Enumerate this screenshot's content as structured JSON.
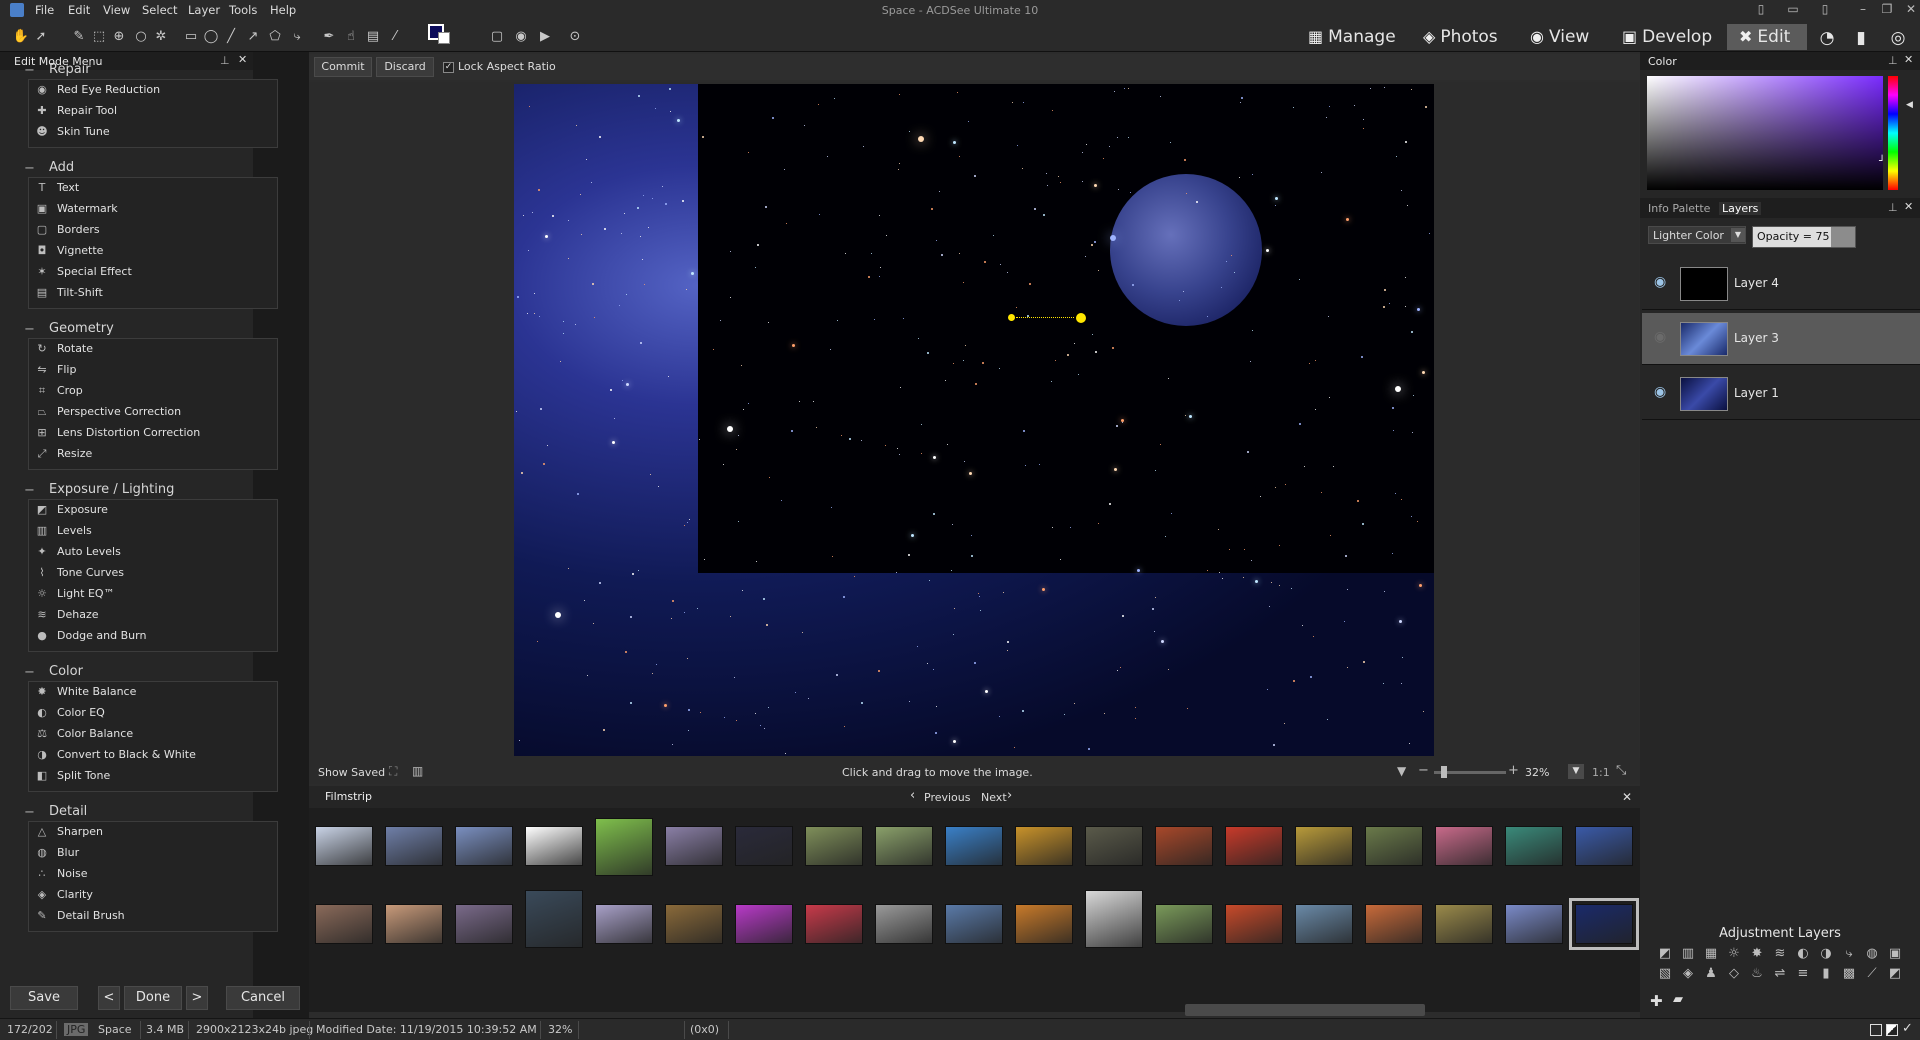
{
  "window": {
    "title": "Space - ACDSee Ultimate 10"
  },
  "menu": [
    "File",
    "Edit",
    "View",
    "Select",
    "Layer",
    "Tools",
    "Help"
  ],
  "modes": [
    {
      "label": "Manage",
      "icon": "grid-icon"
    },
    {
      "label": "Photos",
      "icon": "photos-icon"
    },
    {
      "label": "View",
      "icon": "eye-icon"
    },
    {
      "label": "Develop",
      "icon": "develop-icon"
    },
    {
      "label": "Edit",
      "icon": "edit-icon",
      "active": true
    }
  ],
  "left_panel": {
    "header": "Edit Mode Menu",
    "sections": [
      {
        "title": "Repair",
        "items": [
          {
            "label": "Red Eye Reduction",
            "icon": "eye-icon"
          },
          {
            "label": "Repair Tool",
            "icon": "bandage-icon"
          },
          {
            "label": "Skin Tune",
            "icon": "person-icon"
          }
        ]
      },
      {
        "title": "Add",
        "items": [
          {
            "label": "Text",
            "icon": "text-icon"
          },
          {
            "label": "Watermark",
            "icon": "watermark-icon"
          },
          {
            "label": "Borders",
            "icon": "border-icon"
          },
          {
            "label": "Vignette",
            "icon": "vignette-icon"
          },
          {
            "label": "Special Effect",
            "icon": "effect-icon"
          },
          {
            "label": "Tilt-Shift",
            "icon": "tiltshift-icon"
          }
        ]
      },
      {
        "title": "Geometry",
        "items": [
          {
            "label": "Rotate",
            "icon": "rotate-icon"
          },
          {
            "label": "Flip",
            "icon": "flip-icon"
          },
          {
            "label": "Crop",
            "icon": "crop-icon"
          },
          {
            "label": "Perspective Correction",
            "icon": "perspective-icon"
          },
          {
            "label": "Lens Distortion Correction",
            "icon": "lens-icon"
          },
          {
            "label": "Resize",
            "icon": "resize-icon"
          }
        ]
      },
      {
        "title": "Exposure / Lighting",
        "items": [
          {
            "label": "Exposure",
            "icon": "exposure-icon"
          },
          {
            "label": "Levels",
            "icon": "levels-icon"
          },
          {
            "label": "Auto Levels",
            "icon": "auto-levels-icon"
          },
          {
            "label": "Tone Curves",
            "icon": "curves-icon"
          },
          {
            "label": "Light EQ™",
            "icon": "light-eq-icon"
          },
          {
            "label": "Dehaze",
            "icon": "dehaze-icon"
          },
          {
            "label": "Dodge and Burn",
            "icon": "dodge-icon"
          }
        ]
      },
      {
        "title": "Color",
        "items": [
          {
            "label": "White Balance",
            "icon": "white-balance-icon"
          },
          {
            "label": "Color EQ",
            "icon": "color-eq-icon"
          },
          {
            "label": "Color Balance",
            "icon": "color-balance-icon"
          },
          {
            "label": "Convert to Black & White",
            "icon": "bw-icon"
          },
          {
            "label": "Split Tone",
            "icon": "split-tone-icon"
          }
        ]
      },
      {
        "title": "Detail",
        "items": [
          {
            "label": "Sharpen",
            "icon": "sharpen-icon"
          },
          {
            "label": "Blur",
            "icon": "blur-icon"
          },
          {
            "label": "Noise",
            "icon": "noise-icon"
          },
          {
            "label": "Clarity",
            "icon": "clarity-icon"
          },
          {
            "label": "Detail Brush",
            "icon": "brush-icon"
          }
        ]
      }
    ],
    "buttons": {
      "save": "Save",
      "done": "Done",
      "cancel": "Cancel",
      "prev": "<",
      "next": ">"
    }
  },
  "edit_bar": {
    "commit": "Commit",
    "discard": "Discard",
    "lock_aspect": "Lock Aspect Ratio",
    "lock_checked": true
  },
  "canvas_status": {
    "show_saved": "Show Saved",
    "hint": "Click and drag to move the image.",
    "zoom": "32%",
    "ratio": "1:1"
  },
  "filmstrip": {
    "title": "Filmstrip",
    "previous": "Previous",
    "next": "Next",
    "thumb_count": 38,
    "selected_index": 37
  },
  "right_panel": {
    "color_header": "Color",
    "tabs": [
      "Info Palette",
      "Layers"
    ],
    "active_tab": "Layers",
    "blend_mode": "Lighter Color",
    "opacity_text": "Opacity = 75",
    "layers": [
      {
        "name": "Layer 4",
        "visible": true,
        "selected": false
      },
      {
        "name": "Layer 3",
        "visible": false,
        "selected": true
      },
      {
        "name": "Layer 1",
        "visible": true,
        "selected": false
      }
    ],
    "adjustment_header": "Adjustment Layers"
  },
  "statusbar": {
    "index": "172/202",
    "format": "JPG",
    "filename": "Space",
    "size": "3.4 MB",
    "dimensions": "2900x2123x24b jpeg",
    "modified": "Modified Date: 11/19/2015 10:39:52 AM",
    "zoom": "32%",
    "coords": "(0x0)"
  }
}
